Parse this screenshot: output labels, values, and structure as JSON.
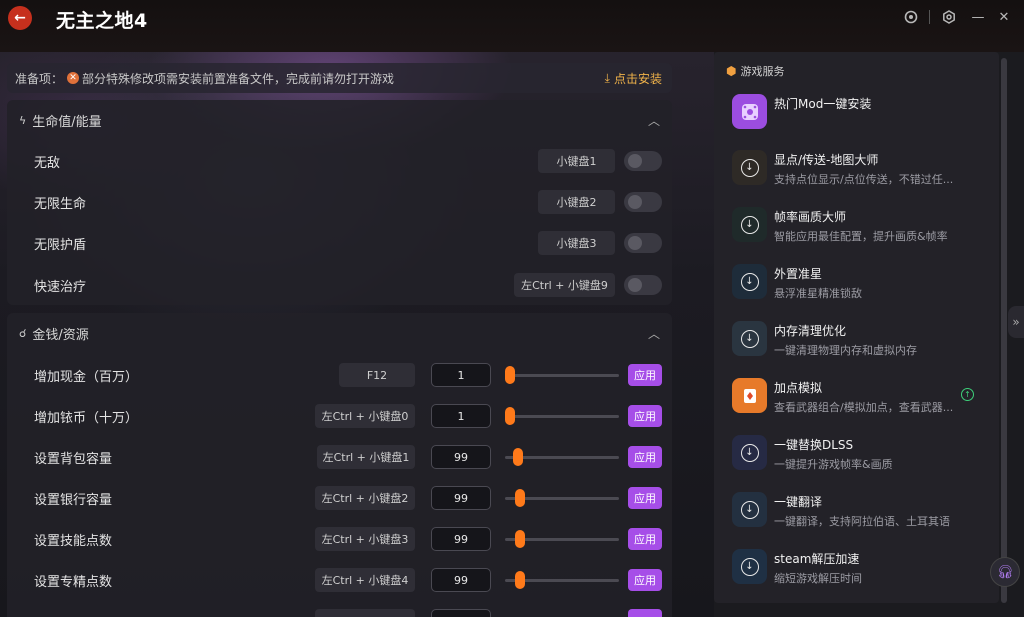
{
  "header": {
    "back_icon": "arrow-left-icon",
    "title": "无主之地4",
    "brand_color": "#c6301d"
  },
  "notice": {
    "prefix": "准备项：",
    "message": "部分特殊修改项需安装前置准备文件，完成前请勿打开游戏",
    "install_label": "点击安装"
  },
  "sections": {
    "health": {
      "title": "生命值/能量",
      "rows": [
        {
          "label": "无敌",
          "hotkey": "小键盘1",
          "enabled": false
        },
        {
          "label": "无限生命",
          "hotkey": "小键盘2",
          "enabled": false
        },
        {
          "label": "无限护盾",
          "hotkey": "小键盘3",
          "enabled": false
        },
        {
          "label": "快速治疗",
          "hotkey": "左Ctrl + 小键盘9",
          "enabled": false
        }
      ]
    },
    "money": {
      "title": "金钱/资源",
      "apply_label": "应用",
      "rows": [
        {
          "label": "增加现金（百万）",
          "hotkey": "F12",
          "value": "1"
        },
        {
          "label": "增加铱币（十万）",
          "hotkey": "左Ctrl + 小键盘0",
          "value": "1"
        },
        {
          "label": "设置背包容量",
          "hotkey": "左Ctrl + 小键盘1",
          "value": "99"
        },
        {
          "label": "设置银行容量",
          "hotkey": "左Ctrl + 小键盘2",
          "value": "99"
        },
        {
          "label": "设置技能点数",
          "hotkey": "左Ctrl + 小键盘3",
          "value": "99"
        },
        {
          "label": "设置专精点数",
          "hotkey": "左Ctrl + 小键盘4",
          "value": "99"
        }
      ]
    }
  },
  "services": {
    "title": "游戏服务",
    "items": [
      {
        "name": "热门Mod一键安装",
        "desc": "",
        "icon": "mod-icon"
      },
      {
        "name": "显点/传送-地图大师",
        "desc": "支持点位显示/点位传送，不错过任...",
        "icon": "download-icon"
      },
      {
        "name": "帧率画质大师",
        "desc": "智能应用最佳配置，提升画质&帧率",
        "icon": "download-icon"
      },
      {
        "name": "外置准星",
        "desc": "悬浮准星精准锁敌",
        "icon": "download-icon"
      },
      {
        "name": "内存清理优化",
        "desc": "一键清理物理内存和虚拟内存",
        "icon": "download-icon"
      },
      {
        "name": "加点模拟",
        "desc": "查看武器组合/模拟加点，查看武器...",
        "icon": "skill-icon"
      },
      {
        "name": "一键替换DLSS",
        "desc": "一键提升游戏帧率&画质",
        "icon": "download-icon"
      },
      {
        "name": "一键翻译",
        "desc": "一键翻译，支持阿拉伯语、土耳其语",
        "icon": "download-icon"
      },
      {
        "name": "steam解压加速",
        "desc": "缩短游戏解压时间",
        "icon": "download-icon"
      }
    ]
  },
  "colors": {
    "accent": "#a64ee8",
    "slider": "#ff7a1a",
    "warning": "#f0b24a"
  }
}
